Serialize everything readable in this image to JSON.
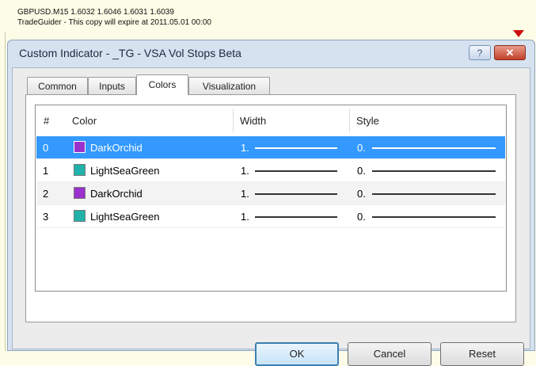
{
  "chart_info": {
    "line1": "GBPUSD.M15  1.6032 1.6046 1.6031 1.6039",
    "line2": "TradeGuider - This copy will expire at 2011.05.01 00:00"
  },
  "dialog": {
    "title": "Custom Indicator - _TG - VSA Vol Stops Beta",
    "help_label": "?",
    "close_label": "✕"
  },
  "tabs": [
    {
      "label": "Common"
    },
    {
      "label": "Inputs"
    },
    {
      "label": "Colors"
    },
    {
      "label": "Visualization"
    }
  ],
  "table": {
    "headers": {
      "num": "#",
      "color": "Color",
      "width": "Width",
      "style": "Style"
    },
    "rows": [
      {
        "num": "0",
        "color_name": "DarkOrchid",
        "swatch": "#9932cc",
        "width": "1.",
        "style": "0."
      },
      {
        "num": "1",
        "color_name": "LightSeaGreen",
        "swatch": "#20b2aa",
        "width": "1.",
        "style": "0."
      },
      {
        "num": "2",
        "color_name": "DarkOrchid",
        "swatch": "#9932cc",
        "width": "1.",
        "style": "0."
      },
      {
        "num": "3",
        "color_name": "LightSeaGreen",
        "swatch": "#20b2aa",
        "width": "1.",
        "style": "0."
      }
    ]
  },
  "buttons": {
    "ok": "OK",
    "cancel": "Cancel",
    "reset": "Reset"
  }
}
